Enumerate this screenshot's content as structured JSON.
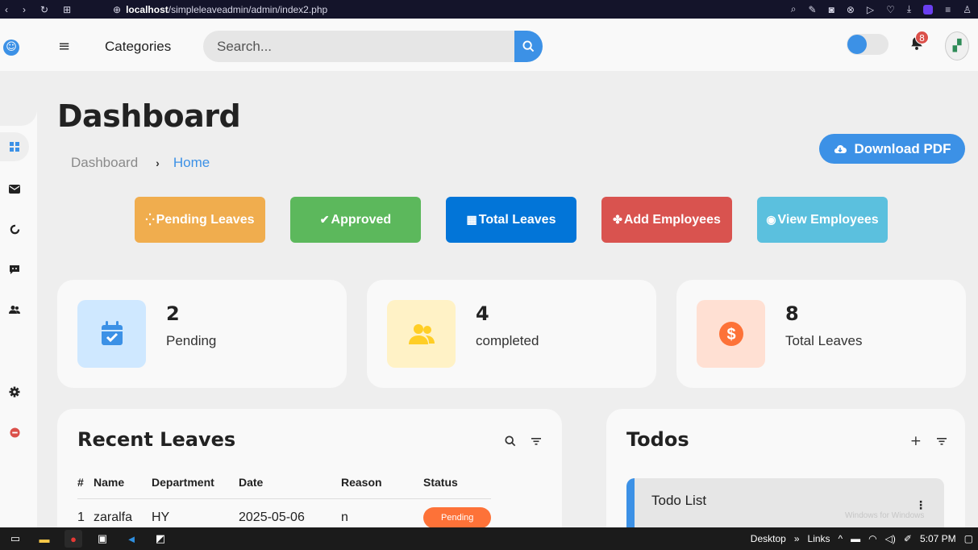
{
  "browser": {
    "url_host": "localhost",
    "url_path": "/simpleleaveadmin/admin/index2.php"
  },
  "topbar": {
    "categories_label": "Categories",
    "search_placeholder": "Search...",
    "notification_count": "8"
  },
  "sidebar": {
    "items": [
      {
        "name": "dashboard",
        "icon": "grid-icon",
        "active": true
      },
      {
        "name": "messages",
        "icon": "envelope-icon"
      },
      {
        "name": "loading",
        "icon": "spinner-icon"
      },
      {
        "name": "chat",
        "icon": "chat-icon"
      },
      {
        "name": "users",
        "icon": "users-icon"
      },
      {
        "name": "settings",
        "icon": "gear-icon"
      },
      {
        "name": "logout",
        "icon": "logout-icon"
      }
    ]
  },
  "main": {
    "title": "Dashboard",
    "breadcrumb": [
      "Dashboard",
      "Home"
    ],
    "download_label": "Download PDF",
    "actions": [
      {
        "label": "Pending Leaves",
        "icon": "spinner-icon",
        "color": "#f0ad4e"
      },
      {
        "label": "Approved",
        "icon": "check-icon",
        "color": "#5cb85c"
      },
      {
        "label": "Total Leaves",
        "icon": "table-icon",
        "color": "#0275d8"
      },
      {
        "label": "Add Employees",
        "icon": "users-icon",
        "color": "#d9534f"
      },
      {
        "label": "View Employees",
        "icon": "eye-icon",
        "color": "#5bc0de"
      }
    ],
    "stats": [
      {
        "value": "2",
        "label": "Pending",
        "icon": "calendar-check-icon",
        "bg": "#cfe8ff",
        "fg": "#3c91e6"
      },
      {
        "value": "4",
        "label": "completed",
        "icon": "users-icon",
        "bg": "#fff2c6",
        "fg": "#ffce26"
      },
      {
        "value": "8",
        "label": "Total Leaves",
        "icon": "dollar-circle-icon",
        "bg": "#ffe0d3",
        "fg": "#fd7238"
      }
    ]
  },
  "recent_leaves": {
    "title": "Recent Leaves",
    "columns": [
      "#",
      "Name",
      "Department",
      "Date",
      "Reason",
      "Status"
    ],
    "rows": [
      {
        "num": "1",
        "name": "zaralfa",
        "department": "HY",
        "date": "2025-05-06",
        "reason": "n",
        "status": "Pending"
      }
    ]
  },
  "todos": {
    "title": "Todos",
    "items": [
      "Todo List"
    ]
  },
  "taskbar": {
    "desktop": "Desktop",
    "links": "Links",
    "time": "5:07 PM"
  },
  "watermark": "Windows for Windows"
}
